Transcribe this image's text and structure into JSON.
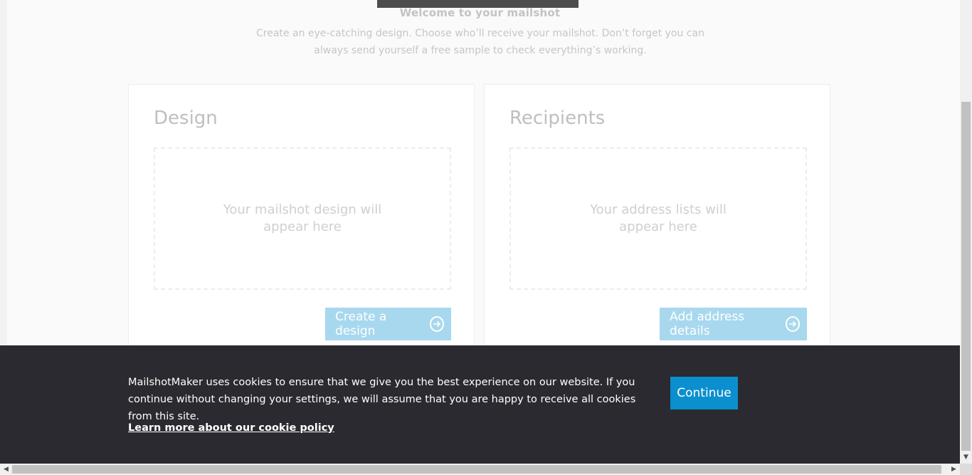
{
  "header": {
    "title": "Welcome to your mailshot",
    "subtitle": "Create an eye-catching design. Choose who’ll receive your mailshot. Don’t forget you can always send yourself a free sample to check everything’s working."
  },
  "cards": {
    "design": {
      "title": "Design",
      "placeholder": "Your mailshot design will appear here",
      "button_label": "Create a design",
      "button_icon": "arrow-right-circle-icon"
    },
    "recipients": {
      "title": "Recipients",
      "placeholder": "Your address lists will appear here",
      "button_label": "Add address details",
      "button_icon": "arrow-right-circle-icon"
    }
  },
  "cookie_banner": {
    "message": "MailshotMaker uses cookies to ensure that we give you the best experience on our website. If you continue without changing your settings, we will assume that you are happy to receive all cookies from this site.",
    "link_text": "Learn more about our cookie policy",
    "continue_label": "Continue"
  },
  "colors": {
    "accent": "#0b8fce",
    "button_disabled": "#a8d8ee",
    "banner_bg": "#2a2a30"
  }
}
